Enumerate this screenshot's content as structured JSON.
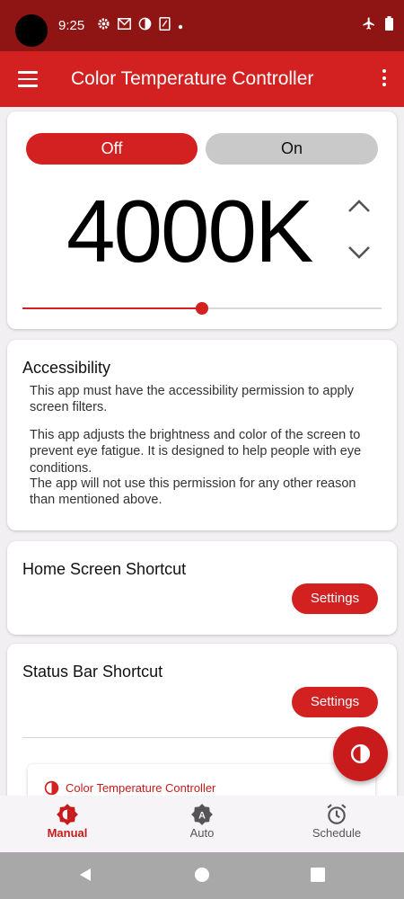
{
  "status_bar": {
    "time": "9:25"
  },
  "app_bar": {
    "title": "Color Temperature Controller"
  },
  "control": {
    "off_label": "Off",
    "on_label": "On",
    "temperature": "4000K",
    "slider_level": 0.5
  },
  "accessibility": {
    "title": "Accessibility",
    "para1": "This app must have the accessibility permission to apply screen filters.",
    "para2": "This app adjusts the brightness and color of the screen to prevent eye fatigue. It is designed to help people with eye conditions.",
    "para3": "The app will not use this permission for any other reason than mentioned above."
  },
  "home_shortcut": {
    "title": "Home Screen Shortcut",
    "button": "Settings"
  },
  "status_shortcut": {
    "title": "Status Bar Shortcut",
    "button": "Settings",
    "preview_label": "Color Temperature Controller"
  },
  "bottom_nav": {
    "items": [
      {
        "label": "Manual",
        "icon": "manual-contrast-icon",
        "active": true
      },
      {
        "label": "Auto",
        "icon": "auto-brightness-icon",
        "active": false
      },
      {
        "label": "Schedule",
        "icon": "alarm-clock-icon",
        "active": false
      }
    ]
  },
  "colors": {
    "primary": "#d32020",
    "status_bar": "#8f1414",
    "background": "#f1eff1"
  }
}
